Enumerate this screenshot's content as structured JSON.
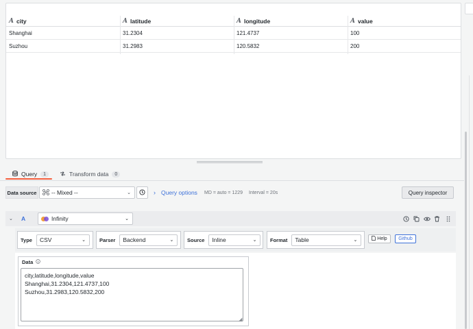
{
  "table": {
    "columns": [
      {
        "type_icon": "A",
        "name": "city"
      },
      {
        "type_icon": "A",
        "name": "latitude"
      },
      {
        "type_icon": "A",
        "name": "longitude"
      },
      {
        "type_icon": "A",
        "name": "value"
      }
    ],
    "rows": [
      [
        "Shanghai",
        "31.2304",
        "121.4737",
        "100"
      ],
      [
        "Suzhou",
        "31.2983",
        "120.5832",
        "200"
      ]
    ]
  },
  "tabs": [
    {
      "label": "Query",
      "count": "1",
      "icon": "database-icon"
    },
    {
      "label": "Transform data",
      "count": "0",
      "icon": "transform-icon"
    }
  ],
  "datasource_row": {
    "label": "Data source",
    "selected": "-- Mixed --",
    "query_options_label": "Query options",
    "md": "MD = auto = 1229",
    "interval": "Interval = 20s",
    "inspector_label": "Query inspector"
  },
  "query": {
    "letter": "A",
    "datasource": "Infinity",
    "fields": {
      "type": {
        "label": "Type",
        "value": "CSV"
      },
      "parser": {
        "label": "Parser",
        "value": "Backend"
      },
      "source": {
        "label": "Source",
        "value": "Inline"
      },
      "format": {
        "label": "Format",
        "value": "Table"
      }
    },
    "help_label": "Help",
    "github_label": "Github",
    "data_label": "Data",
    "data_text": "city,latitude,longitude,value\nShanghai,31.2304,121.4737,100\nSuzhou,31.2983,120.5832,200"
  },
  "colors": {
    "accent_blue": "#3d71d9",
    "active_tab_underline": "#f55f3e"
  }
}
